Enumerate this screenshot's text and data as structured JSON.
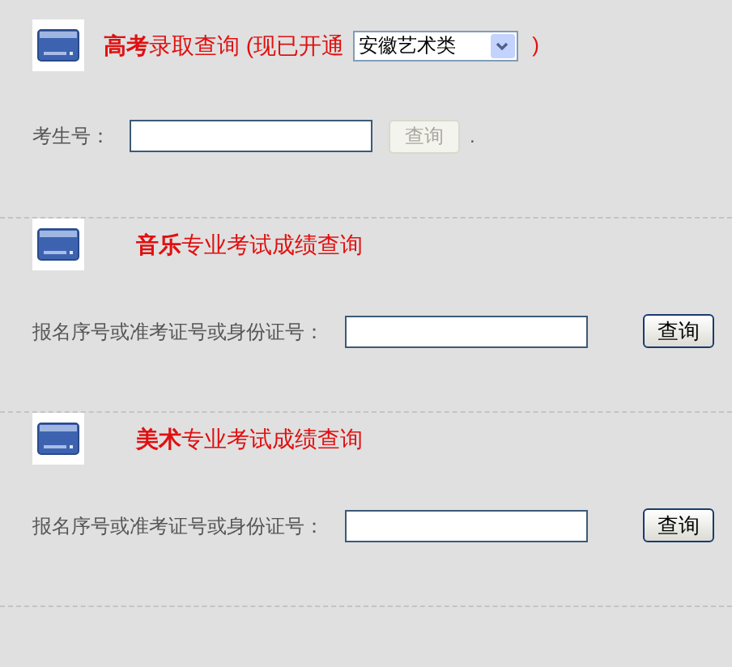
{
  "sections": [
    {
      "kind": "admission",
      "title": "**高考**录取查询 (现已开通",
      "select": {
        "value": "安徽艺术类"
      },
      "closing": ")",
      "field_label": "考生号：",
      "button": {
        "label": "查询",
        "disabled": true
      },
      "trailing": "."
    },
    {
      "kind": "score",
      "title": "**音乐**专业考试成绩查询",
      "field_label": "报名序号或准考证号或身份证号：",
      "button": {
        "label": "查询",
        "disabled": false
      }
    },
    {
      "kind": "score",
      "title": "**美术**专业考试成绩查询",
      "field_label": "报名序号或准考证号或身份证号：",
      "button": {
        "label": "查询",
        "disabled": false
      }
    }
  ]
}
